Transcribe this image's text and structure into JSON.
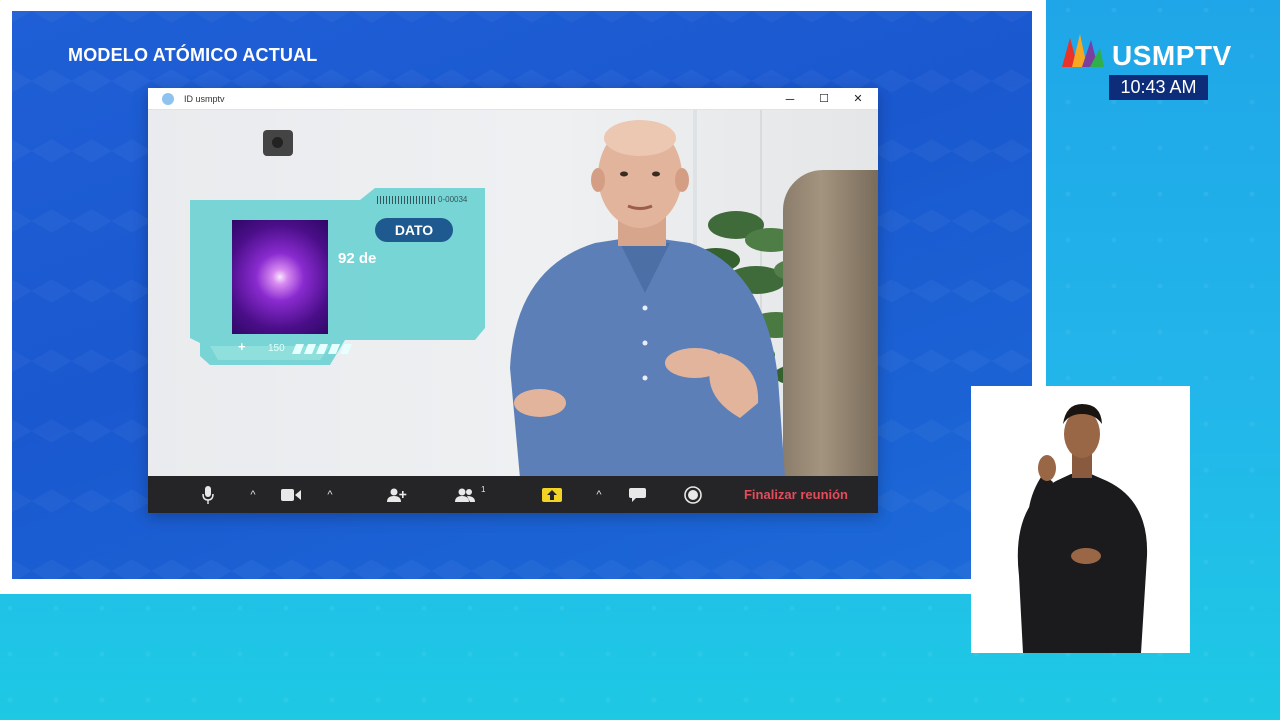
{
  "segment": {
    "title": "MODELO ATÓMICO ACTUAL"
  },
  "window": {
    "title": "ID usmptv",
    "minimize": "─",
    "maximize": "☐",
    "close": "✕"
  },
  "dato_card": {
    "badge": "DATO",
    "text": "92 de",
    "code": "0-00034",
    "count": "150",
    "plus": "+"
  },
  "toolbar": {
    "participants_count": "1",
    "end_meeting_label": "Finalizar reunión",
    "caret": "^"
  },
  "brand": {
    "name": "USMPTV",
    "time": "10:43 AM"
  },
  "colors": {
    "panel_blue": "#1f5fd6",
    "card_teal": "#72d3d3",
    "end_red": "#e24c5b",
    "share_yellow": "#f3d324"
  }
}
